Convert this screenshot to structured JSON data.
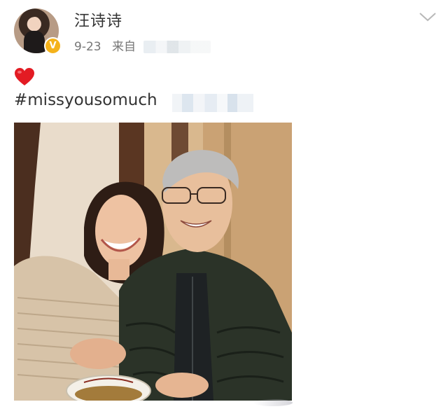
{
  "post": {
    "author": {
      "name": "汪诗诗",
      "verified_badge": "V",
      "badge_color": "#f4b21b"
    },
    "date": "9-23",
    "source_prefix": "来自",
    "heart_emoji": "heart-icon",
    "hashtag_text": "#missyousomuch",
    "icons": {
      "more": "chevron-down-icon",
      "heart": "heart-icon"
    },
    "colors": {
      "heart": "#e31b23",
      "text": "#333333",
      "meta": "#777777"
    }
  }
}
